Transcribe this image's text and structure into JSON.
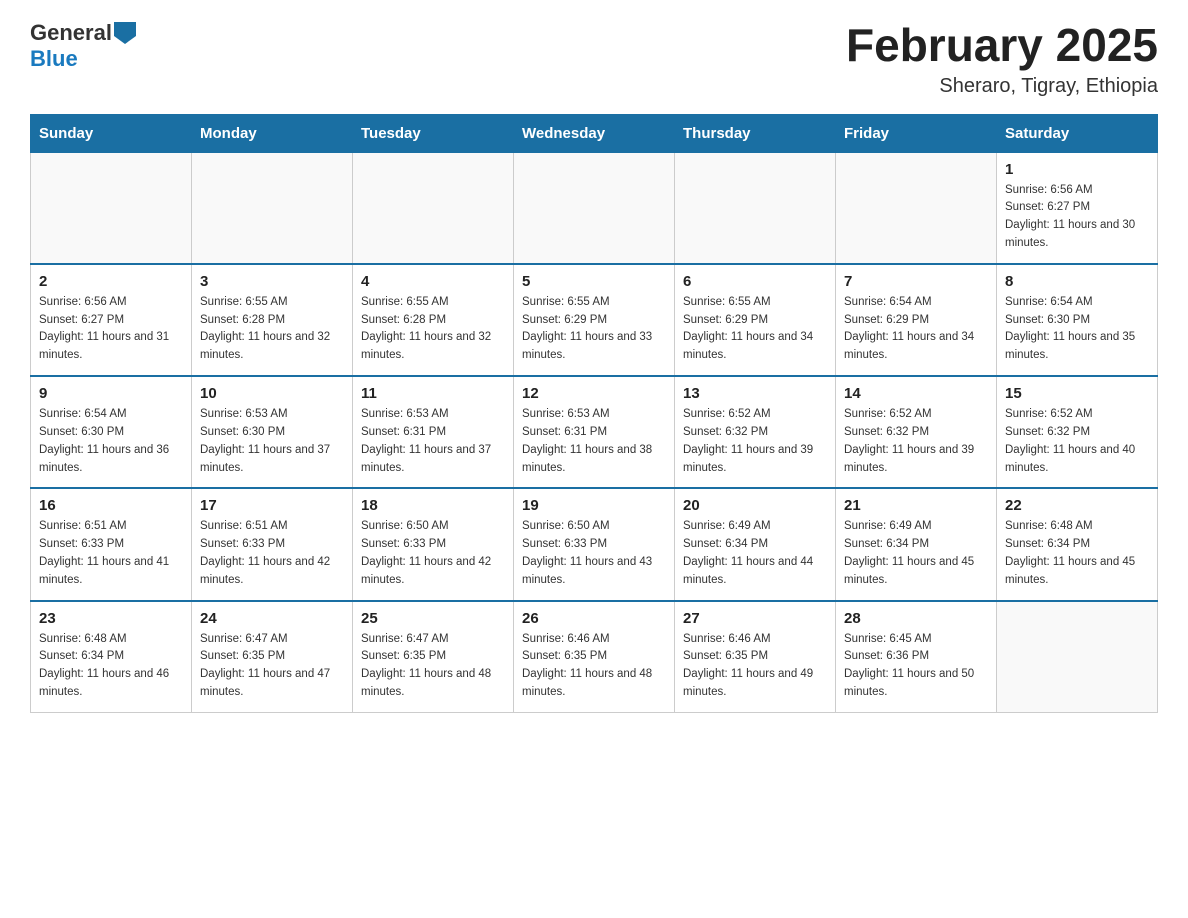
{
  "header": {
    "logo_general": "General",
    "logo_blue": "Blue",
    "month_title": "February 2025",
    "location": "Sheraro, Tigray, Ethiopia"
  },
  "weekdays": [
    "Sunday",
    "Monday",
    "Tuesday",
    "Wednesday",
    "Thursday",
    "Friday",
    "Saturday"
  ],
  "weeks": [
    [
      {
        "day": "",
        "sunrise": "",
        "sunset": "",
        "daylight": ""
      },
      {
        "day": "",
        "sunrise": "",
        "sunset": "",
        "daylight": ""
      },
      {
        "day": "",
        "sunrise": "",
        "sunset": "",
        "daylight": ""
      },
      {
        "day": "",
        "sunrise": "",
        "sunset": "",
        "daylight": ""
      },
      {
        "day": "",
        "sunrise": "",
        "sunset": "",
        "daylight": ""
      },
      {
        "day": "",
        "sunrise": "",
        "sunset": "",
        "daylight": ""
      },
      {
        "day": "1",
        "sunrise": "Sunrise: 6:56 AM",
        "sunset": "Sunset: 6:27 PM",
        "daylight": "Daylight: 11 hours and 30 minutes."
      }
    ],
    [
      {
        "day": "2",
        "sunrise": "Sunrise: 6:56 AM",
        "sunset": "Sunset: 6:27 PM",
        "daylight": "Daylight: 11 hours and 31 minutes."
      },
      {
        "day": "3",
        "sunrise": "Sunrise: 6:55 AM",
        "sunset": "Sunset: 6:28 PM",
        "daylight": "Daylight: 11 hours and 32 minutes."
      },
      {
        "day": "4",
        "sunrise": "Sunrise: 6:55 AM",
        "sunset": "Sunset: 6:28 PM",
        "daylight": "Daylight: 11 hours and 32 minutes."
      },
      {
        "day": "5",
        "sunrise": "Sunrise: 6:55 AM",
        "sunset": "Sunset: 6:29 PM",
        "daylight": "Daylight: 11 hours and 33 minutes."
      },
      {
        "day": "6",
        "sunrise": "Sunrise: 6:55 AM",
        "sunset": "Sunset: 6:29 PM",
        "daylight": "Daylight: 11 hours and 34 minutes."
      },
      {
        "day": "7",
        "sunrise": "Sunrise: 6:54 AM",
        "sunset": "Sunset: 6:29 PM",
        "daylight": "Daylight: 11 hours and 34 minutes."
      },
      {
        "day": "8",
        "sunrise": "Sunrise: 6:54 AM",
        "sunset": "Sunset: 6:30 PM",
        "daylight": "Daylight: 11 hours and 35 minutes."
      }
    ],
    [
      {
        "day": "9",
        "sunrise": "Sunrise: 6:54 AM",
        "sunset": "Sunset: 6:30 PM",
        "daylight": "Daylight: 11 hours and 36 minutes."
      },
      {
        "day": "10",
        "sunrise": "Sunrise: 6:53 AM",
        "sunset": "Sunset: 6:30 PM",
        "daylight": "Daylight: 11 hours and 37 minutes."
      },
      {
        "day": "11",
        "sunrise": "Sunrise: 6:53 AM",
        "sunset": "Sunset: 6:31 PM",
        "daylight": "Daylight: 11 hours and 37 minutes."
      },
      {
        "day": "12",
        "sunrise": "Sunrise: 6:53 AM",
        "sunset": "Sunset: 6:31 PM",
        "daylight": "Daylight: 11 hours and 38 minutes."
      },
      {
        "day": "13",
        "sunrise": "Sunrise: 6:52 AM",
        "sunset": "Sunset: 6:32 PM",
        "daylight": "Daylight: 11 hours and 39 minutes."
      },
      {
        "day": "14",
        "sunrise": "Sunrise: 6:52 AM",
        "sunset": "Sunset: 6:32 PM",
        "daylight": "Daylight: 11 hours and 39 minutes."
      },
      {
        "day": "15",
        "sunrise": "Sunrise: 6:52 AM",
        "sunset": "Sunset: 6:32 PM",
        "daylight": "Daylight: 11 hours and 40 minutes."
      }
    ],
    [
      {
        "day": "16",
        "sunrise": "Sunrise: 6:51 AM",
        "sunset": "Sunset: 6:33 PM",
        "daylight": "Daylight: 11 hours and 41 minutes."
      },
      {
        "day": "17",
        "sunrise": "Sunrise: 6:51 AM",
        "sunset": "Sunset: 6:33 PM",
        "daylight": "Daylight: 11 hours and 42 minutes."
      },
      {
        "day": "18",
        "sunrise": "Sunrise: 6:50 AM",
        "sunset": "Sunset: 6:33 PM",
        "daylight": "Daylight: 11 hours and 42 minutes."
      },
      {
        "day": "19",
        "sunrise": "Sunrise: 6:50 AM",
        "sunset": "Sunset: 6:33 PM",
        "daylight": "Daylight: 11 hours and 43 minutes."
      },
      {
        "day": "20",
        "sunrise": "Sunrise: 6:49 AM",
        "sunset": "Sunset: 6:34 PM",
        "daylight": "Daylight: 11 hours and 44 minutes."
      },
      {
        "day": "21",
        "sunrise": "Sunrise: 6:49 AM",
        "sunset": "Sunset: 6:34 PM",
        "daylight": "Daylight: 11 hours and 45 minutes."
      },
      {
        "day": "22",
        "sunrise": "Sunrise: 6:48 AM",
        "sunset": "Sunset: 6:34 PM",
        "daylight": "Daylight: 11 hours and 45 minutes."
      }
    ],
    [
      {
        "day": "23",
        "sunrise": "Sunrise: 6:48 AM",
        "sunset": "Sunset: 6:34 PM",
        "daylight": "Daylight: 11 hours and 46 minutes."
      },
      {
        "day": "24",
        "sunrise": "Sunrise: 6:47 AM",
        "sunset": "Sunset: 6:35 PM",
        "daylight": "Daylight: 11 hours and 47 minutes."
      },
      {
        "day": "25",
        "sunrise": "Sunrise: 6:47 AM",
        "sunset": "Sunset: 6:35 PM",
        "daylight": "Daylight: 11 hours and 48 minutes."
      },
      {
        "day": "26",
        "sunrise": "Sunrise: 6:46 AM",
        "sunset": "Sunset: 6:35 PM",
        "daylight": "Daylight: 11 hours and 48 minutes."
      },
      {
        "day": "27",
        "sunrise": "Sunrise: 6:46 AM",
        "sunset": "Sunset: 6:35 PM",
        "daylight": "Daylight: 11 hours and 49 minutes."
      },
      {
        "day": "28",
        "sunrise": "Sunrise: 6:45 AM",
        "sunset": "Sunset: 6:36 PM",
        "daylight": "Daylight: 11 hours and 50 minutes."
      },
      {
        "day": "",
        "sunrise": "",
        "sunset": "",
        "daylight": ""
      }
    ]
  ]
}
